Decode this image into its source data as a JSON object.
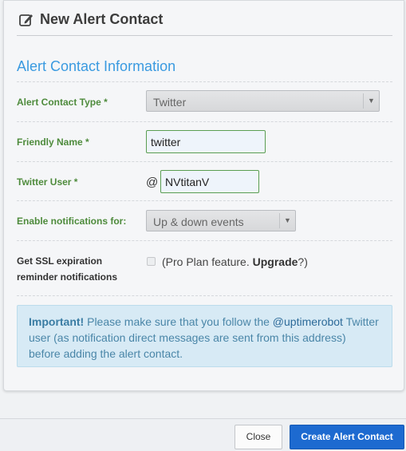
{
  "header": {
    "title": "New Alert Contact",
    "icon": "edit-icon"
  },
  "section": {
    "title": "Alert Contact Information"
  },
  "fields": {
    "contact_type": {
      "label": "Alert Contact Type *",
      "value": "Twitter"
    },
    "friendly_name": {
      "label": "Friendly Name *",
      "value": "twitter"
    },
    "twitter_user": {
      "label": "Twitter User *",
      "prefix": "@",
      "value": "NVtitanV"
    },
    "notifications": {
      "label": "Enable notifications for:",
      "value": "Up & down events"
    },
    "ssl": {
      "label_line1": "Get SSL expiration",
      "label_line2": "reminder notifications",
      "text_before": "(Pro Plan feature. ",
      "upgrade": "Upgrade",
      "text_after": "?)",
      "checked": false
    }
  },
  "alert": {
    "strong": "Important!",
    "text1": " Please make sure that you follow the ",
    "mention": "@uptimerobot",
    "text2": " Twitter user (as notification direct messages are sent from this address) before adding the alert contact."
  },
  "footer": {
    "close_label": "Close",
    "create_label": "Create Alert Contact"
  },
  "colors": {
    "accent": "#3a9ae0",
    "label_green": "#4e8b3c",
    "primary_button": "#1d6ad0",
    "alert_bg": "#d7eaf5"
  }
}
